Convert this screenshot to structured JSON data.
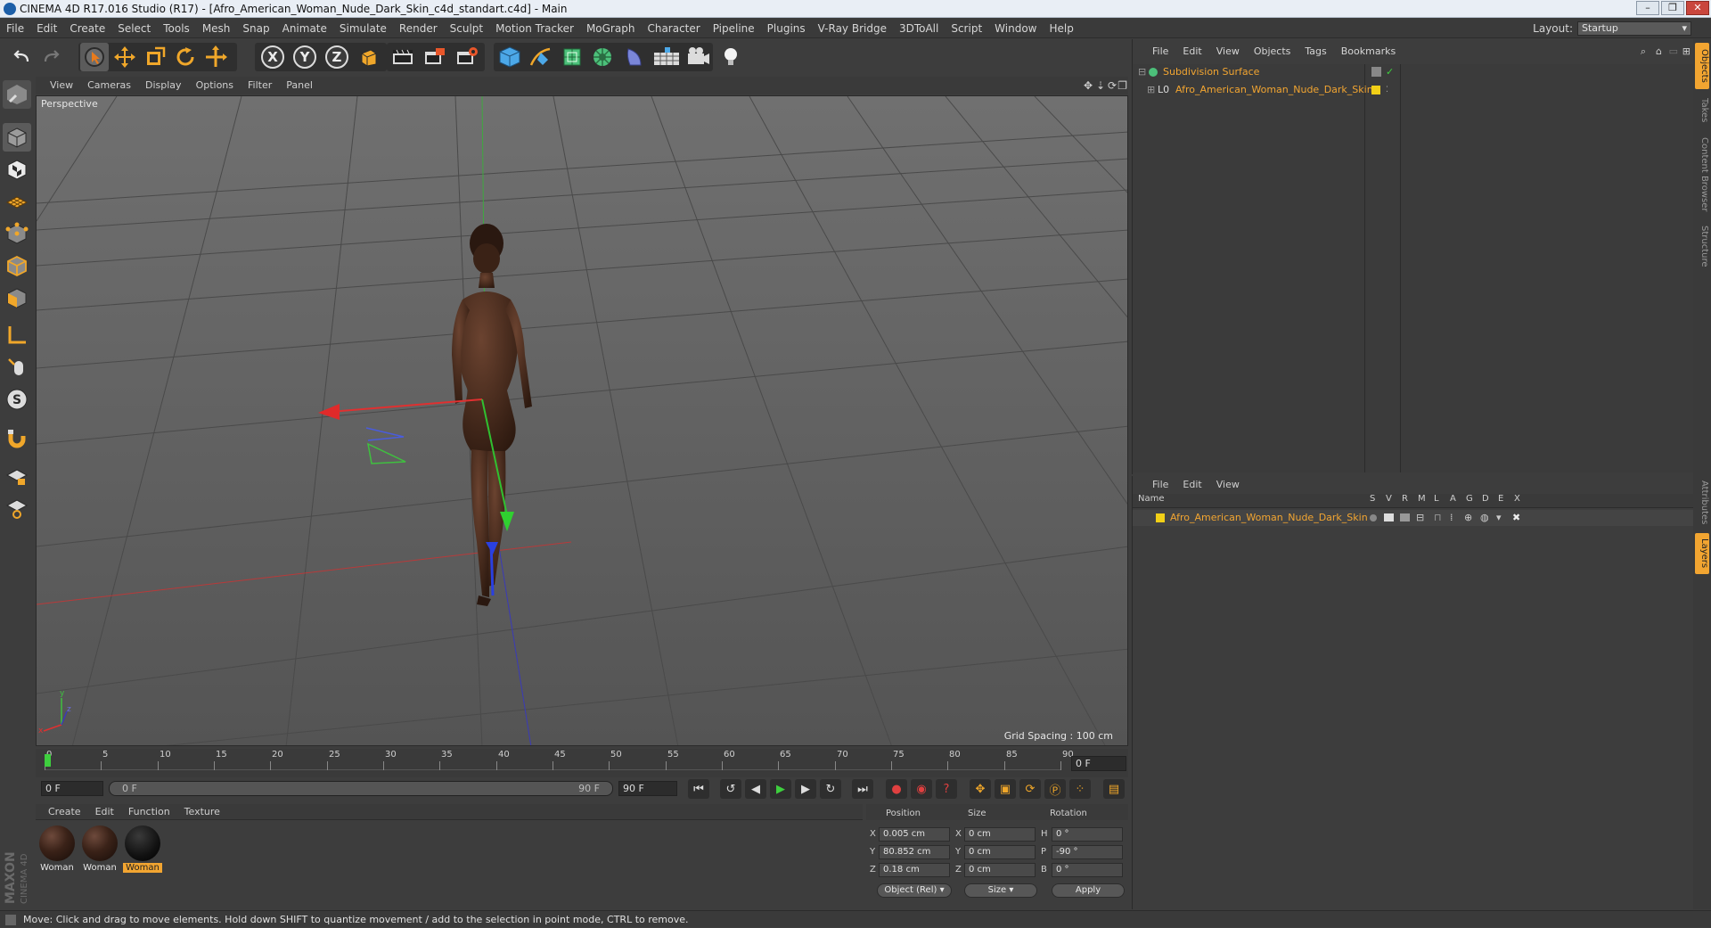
{
  "window": {
    "title": "CINEMA 4D R17.016 Studio (R17) - [Afro_American_Woman_Nude_Dark_Skin_c4d_standart.c4d] - Main",
    "controls": [
      "–",
      "❐",
      "✕"
    ]
  },
  "menubar": {
    "items": [
      "File",
      "Edit",
      "Create",
      "Select",
      "Tools",
      "Mesh",
      "Snap",
      "Animate",
      "Simulate",
      "Render",
      "Sculpt",
      "Motion Tracker",
      "MoGraph",
      "Character",
      "Pipeline",
      "Plugins",
      "V-Ray Bridge",
      "3DToAll",
      "Script",
      "Window",
      "Help"
    ],
    "layout_label": "Layout:",
    "layout_value": "Startup"
  },
  "toolbar": {
    "icons": [
      "undo-icon",
      "redo-icon",
      "live-select-icon",
      "move-icon",
      "scale-icon",
      "rotate-icon",
      "recent-tool-icon",
      "x-axis-icon",
      "y-axis-icon",
      "z-axis-icon",
      "world-coords-icon",
      "render-view-icon",
      "render-picture-viewer-icon",
      "render-settings-icon",
      "cube-icon",
      "pen-icon",
      "subdivision-icon",
      "mograph-cloner-icon",
      "deformer-icon",
      "floor-icon",
      "camera-icon",
      "light-icon"
    ],
    "axis_labels": [
      "X",
      "Y",
      "Z"
    ]
  },
  "viewport": {
    "menu": [
      "View",
      "Cameras",
      "Display",
      "Options",
      "Filter",
      "Panel"
    ],
    "label": "Perspective",
    "grid_spacing": "Grid Spacing : 100 cm"
  },
  "timeline": {
    "ticks": [
      "0",
      "5",
      "10",
      "15",
      "20",
      "25",
      "30",
      "35",
      "40",
      "45",
      "50",
      "55",
      "60",
      "65",
      "70",
      "75",
      "80",
      "85",
      "90"
    ],
    "current_frame": "0 F",
    "start_field": "0 F",
    "range_start": "0 F",
    "range_end": "90 F",
    "end_field": "90 F"
  },
  "materials": {
    "menu": [
      "Create",
      "Edit",
      "Function",
      "Texture"
    ],
    "items": [
      {
        "label": "Woman",
        "selected": false
      },
      {
        "label": "Woman",
        "selected": false
      },
      {
        "label": "Woman",
        "selected": true
      }
    ]
  },
  "coordinates": {
    "headers": [
      "Position",
      "Size",
      "Rotation"
    ],
    "rows": [
      {
        "axis": "X",
        "position": "0.005 cm",
        "size_axis": "X",
        "size": "0 cm",
        "rot_axis": "H",
        "rotation": "0 °"
      },
      {
        "axis": "Y",
        "position": "80.852 cm",
        "size_axis": "Y",
        "size": "0 cm",
        "rot_axis": "P",
        "rotation": "-90 °"
      },
      {
        "axis": "Z",
        "position": "0.18 cm",
        "size_axis": "Z",
        "size": "0 cm",
        "rot_axis": "B",
        "rotation": "0 °"
      }
    ],
    "mode_select": "Object (Rel)",
    "size_select": "Size",
    "apply_label": "Apply"
  },
  "object_manager": {
    "menu": [
      "File",
      "Edit",
      "View",
      "Objects",
      "Tags",
      "Bookmarks"
    ],
    "objects": [
      {
        "name": "Subdivision Surface",
        "level": 0
      },
      {
        "name": "Afro_American_Woman_Nude_Dark_Skin",
        "level": 1
      }
    ]
  },
  "layer_manager": {
    "menu": [
      "File",
      "Edit",
      "View"
    ],
    "name_header": "Name",
    "flag_headers": [
      "S",
      "V",
      "R",
      "M",
      "L",
      "A",
      "G",
      "D",
      "E",
      "X"
    ],
    "layers": [
      {
        "name": "Afro_American_Woman_Nude_Dark_Skin",
        "color": "#f2d017"
      }
    ]
  },
  "side_tabs": [
    "Objects",
    "Takes",
    "Content Browser",
    "Structure",
    "Attributes",
    "Layers"
  ],
  "status": "Move: Click and drag to move elements. Hold down SHIFT to quantize movement / add to the selection in point mode, CTRL to remove.",
  "logo": {
    "line1": "MAXON",
    "line2": "CINEMA 4D"
  },
  "colors": {
    "accent": "#f2a531",
    "layer": "#f2d017",
    "viewport_bg": "#5c5c5c"
  }
}
